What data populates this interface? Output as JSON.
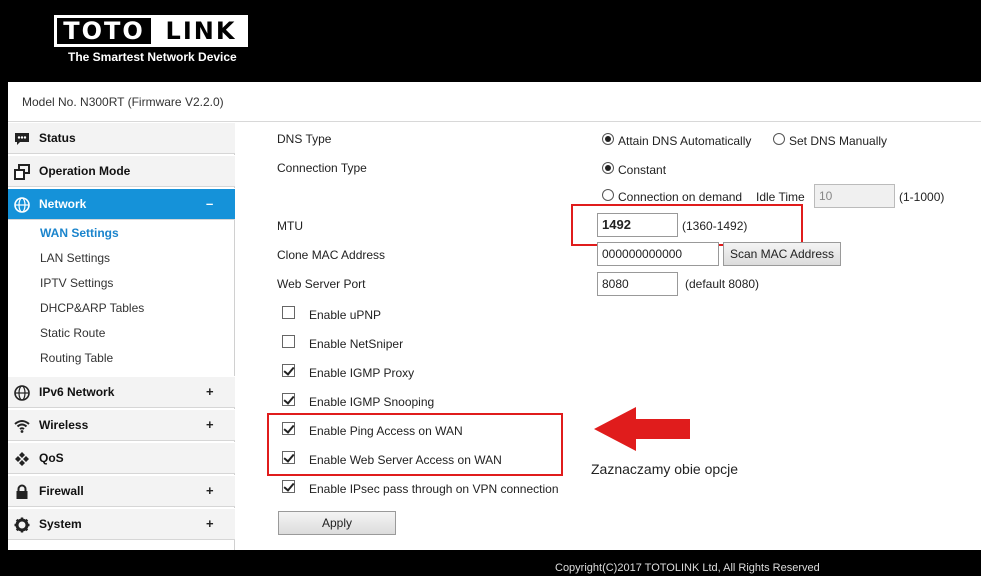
{
  "brand": {
    "logo_part1": "TOTO",
    "logo_part2": "LINK",
    "tagline": "The Smartest Network Device"
  },
  "model_bar": {
    "text": "Model No. N300RT (Firmware V2.2.0)"
  },
  "sidebar": {
    "menu": [
      {
        "label": "Status",
        "icon": "chat-icon",
        "toggle": ""
      },
      {
        "label": "Operation Mode",
        "icon": "window-icon",
        "toggle": ""
      },
      {
        "label": "Network",
        "icon": "globe-icon",
        "toggle": "–"
      },
      {
        "label": "IPv6 Network",
        "icon": "globe-icon",
        "toggle": "+"
      },
      {
        "label": "Wireless",
        "icon": "wifi-icon",
        "toggle": "+"
      },
      {
        "label": "QoS",
        "icon": "qos-icon",
        "toggle": ""
      },
      {
        "label": "Firewall",
        "icon": "lock-icon",
        "toggle": "+"
      },
      {
        "label": "System",
        "icon": "gear-icon",
        "toggle": "+"
      }
    ],
    "network_submenu": [
      "WAN Settings",
      "LAN Settings",
      "IPTV Settings",
      "DHCP&ARP Tables",
      "Static Route",
      "Routing Table"
    ],
    "active_submenu": "WAN Settings",
    "accent_color": "#1592d9"
  },
  "form": {
    "dns_type": {
      "label": "DNS Type",
      "option_auto": "Attain DNS Automatically",
      "option_manual": "Set DNS Manually",
      "selected": "auto"
    },
    "connection_type": {
      "label": "Connection Type",
      "option_constant": "Constant",
      "option_demand": "Connection on demand",
      "idle_time_label": "Idle Time",
      "idle_time_value": "10",
      "idle_time_range": "(1-1000)",
      "selected": "constant"
    },
    "mtu": {
      "label": "MTU",
      "value": "1492",
      "range": "(1360-1492)"
    },
    "clone_mac": {
      "label": "Clone MAC Address",
      "value": "000000000000",
      "button": "Scan MAC Address"
    },
    "web_server_port": {
      "label": "Web Server Port",
      "value": "8080",
      "hint": "(default 8080)"
    },
    "checkboxes": [
      {
        "label": "Enable uPNP",
        "checked": false
      },
      {
        "label": "Enable NetSniper",
        "checked": false
      },
      {
        "label": "Enable IGMP Proxy",
        "checked": true
      },
      {
        "label": "Enable IGMP Snooping",
        "checked": true
      },
      {
        "label": "Enable Ping Access on WAN",
        "checked": true
      },
      {
        "label": "Enable Web Server Access on WAN",
        "checked": true
      },
      {
        "label": "Enable IPsec pass through on VPN connection",
        "checked": true
      }
    ],
    "apply_button": "Apply"
  },
  "annotation": {
    "text": "Zaznaczamy obie opcje",
    "color": "#e01c1c"
  },
  "footer": {
    "copyright": "Copyright(C)2017 TOTOLINK Ltd, All Rights Reserved"
  }
}
